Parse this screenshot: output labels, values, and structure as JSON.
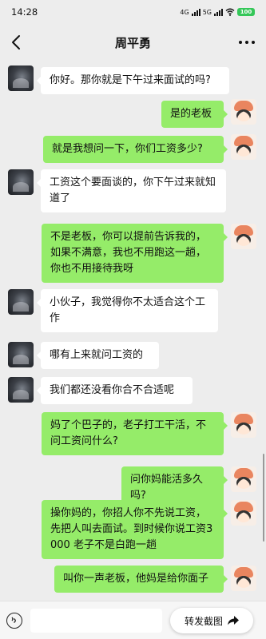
{
  "status_bar": {
    "time": "14:28",
    "network": "4G",
    "network2": "5G",
    "battery": "100"
  },
  "nav": {
    "title": "周平勇"
  },
  "messages": [
    {
      "side": "left",
      "avatar": "cave-avatar",
      "text": "你好。那你就是下午过来面试的吗?"
    },
    {
      "side": "right",
      "avatar": "cartoon-girl-avatar",
      "text": "是的老板"
    },
    {
      "side": "right",
      "avatar": "cartoon-girl-avatar",
      "text": "就是我想问一下，你们工资多少?"
    },
    {
      "side": "left",
      "avatar": "cave-avatar",
      "text": "工资这个要面谈的，你下午过来就知道了"
    },
    {
      "side": "right",
      "avatar": "cartoon-girl-avatar",
      "text": "不是老板，你可以提前告诉我的，如果不满意，我也不用跑这一趟，你也不用接待我呀"
    },
    {
      "side": "left",
      "avatar": "cave-avatar",
      "text": "小伙子，我觉得你不太适合这个工作"
    },
    {
      "side": "left",
      "avatar": "cave-avatar",
      "text": "哪有上来就问工资的"
    },
    {
      "side": "left",
      "avatar": "cave-avatar",
      "text": "我们都还没看你合不合适呢"
    },
    {
      "side": "right",
      "avatar": "cartoon-girl-avatar",
      "text": "妈了个巴子的，老子打工干活，不问工资问什么?"
    },
    {
      "side": "right",
      "avatar": "cartoon-girl-avatar",
      "text": "问你妈能活多久吗?"
    },
    {
      "side": "right",
      "avatar": "cartoon-girl-avatar",
      "text": "操你妈的，你招人你不先说工资，先把人叫去面试。到时候你说工资3000 老子不是白跑一趟"
    },
    {
      "side": "right",
      "avatar": "cartoon-girl-avatar",
      "text": "叫你一声老板，他妈是给你面子"
    }
  ],
  "input_bar": {
    "forward_label": "转发截图"
  },
  "colors": {
    "background": "#ededed",
    "self_bubble": "#95ec69",
    "other_bubble": "#ffffff"
  }
}
